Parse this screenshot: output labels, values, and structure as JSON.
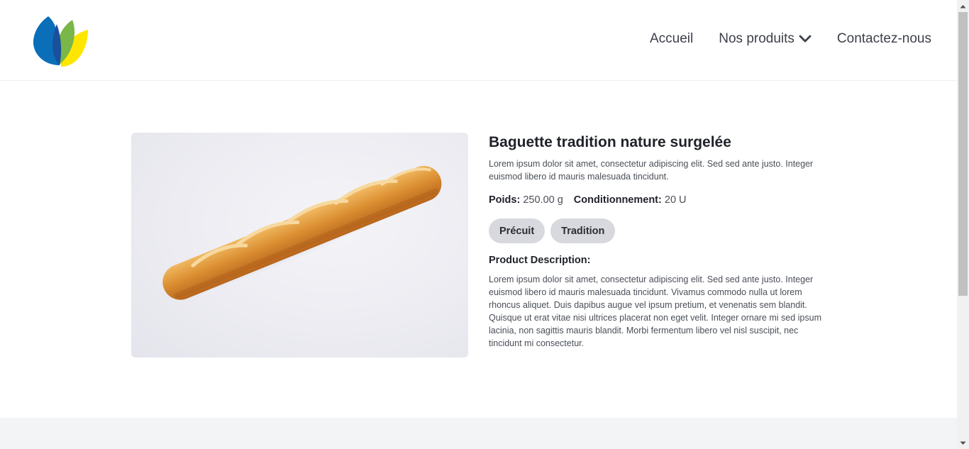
{
  "header": {
    "logo_colors": [
      "#0a6fb8",
      "#7ab648",
      "#ffe600"
    ],
    "nav": [
      {
        "label": "Accueil"
      },
      {
        "label": "Nos produits",
        "has_dropdown": true
      },
      {
        "label": "Contactez-nous"
      }
    ]
  },
  "product": {
    "title": "Baguette tradition nature surgelée",
    "lead": "Lorem ipsum dolor sit amet, consectetur adipiscing elit. Sed sed ante justo. Integer euismod libero id mauris malesuada tincidunt.",
    "weight_label": "Poids:",
    "weight_value": "250.00 g",
    "packaging_label": "Conditionnement:",
    "packaging_value": "20 U",
    "tags": [
      "Précuit",
      "Tradition"
    ],
    "description_title": "Product Description:",
    "description": "Lorem ipsum dolor sit amet, consectetur adipiscing elit. Sed sed ante justo. Integer euismod libero id mauris malesuada tincidunt. Vivamus commodo nulla ut lorem rhoncus aliquet. Duis dapibus augue vel ipsum pretium, et venenatis sem blandit. Quisque ut erat vitae nisi ultrices placerat non eget velit. Integer ornare mi sed ipsum lacinia, non sagittis mauris blandit. Morbi fermentum libero vel nisl suscipit, nec tincidunt mi consectetur."
  }
}
